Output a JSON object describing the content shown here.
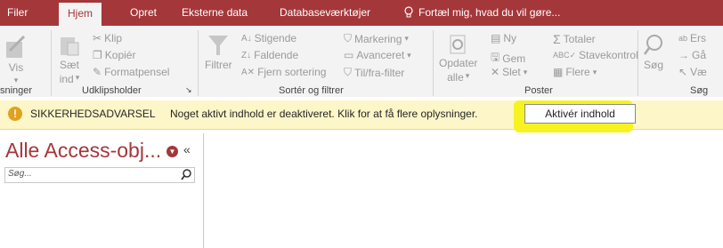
{
  "tabs": [
    {
      "label": "Filer"
    },
    {
      "label": "Hjem",
      "active": true
    },
    {
      "label": "Opret"
    },
    {
      "label": "Eksterne data"
    },
    {
      "label": "Databaseværktøjer"
    }
  ],
  "tell_me": "Fortæl mig, hvad du vil gøre...",
  "ribbon": {
    "visninger": {
      "vis": "Vis",
      "group": "sninger"
    },
    "udklip": {
      "saet": "Sæt",
      "ind": "ind",
      "klip": "Klip",
      "kopier": "Kopiér",
      "format": "Formatpensel",
      "group": "Udklipsholder"
    },
    "sort": {
      "filtrer": "Filtrer",
      "stigende": "Stigende",
      "faldende": "Faldende",
      "fjern": "Fjern sortering",
      "markering": "Markering",
      "avanceret": "Avanceret",
      "tilfra": "Til/fra-filter",
      "group": "Sortér og filtrer"
    },
    "poster": {
      "opdater": "Opdater",
      "alle": "alle",
      "ny": "Ny",
      "gem": "Gem",
      "slet": "Slet",
      "totaler": "Totaler",
      "stavekontrol": "Stavekontrol",
      "flere": "Flere",
      "group": "Poster"
    },
    "sog": {
      "sog": "Søg",
      "ers": "Ers",
      "ga": "Gå",
      "vae": "Væ",
      "group": "Søg"
    }
  },
  "warning": {
    "title": "SIKKERHEDSADVARSEL",
    "message": "Noget aktivt indhold er deaktiveret. Klik for at få flere oplysninger.",
    "button": "Aktivér indhold"
  },
  "nav": {
    "title": "Alle Access-obj...",
    "collapse": "«",
    "search_placeholder": "Søg..."
  },
  "colors": {
    "accent": "#a4373a",
    "warning_bg": "#fdf6c8",
    "highlight": "#f7f320"
  }
}
